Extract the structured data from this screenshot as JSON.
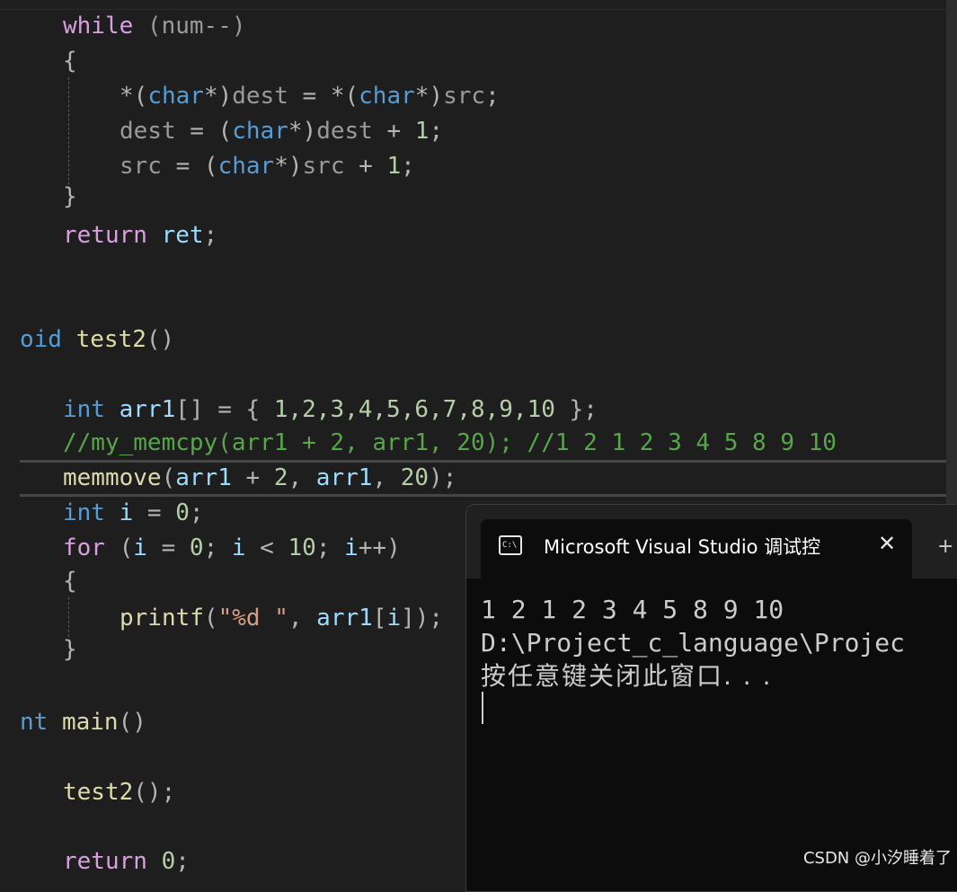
{
  "editor": {
    "lines": {
      "l1": {
        "kw": "while",
        "rest": " (num--)"
      },
      "l2": {
        "text": "{"
      },
      "l3": {
        "a": "*(",
        "t1": "char",
        "b": "*)",
        "v1": "dest",
        "c": " = *(",
        "t2": "char",
        "d": "*)",
        "v2": "src",
        "e": ";"
      },
      "l4": {
        "v1": "dest",
        "a": " = (",
        "t1": "char",
        "b": "*)",
        "v2": "dest",
        "c": " + ",
        "n": "1",
        "d": ";"
      },
      "l5": {
        "v1": "src",
        "a": " = (",
        "t1": "char",
        "b": "*)",
        "v2": "src",
        "c": " + ",
        "n": "1",
        "d": ";"
      },
      "l6": {
        "text": "}"
      },
      "l7": {
        "kw": "return",
        "v": "ret",
        "p": ";"
      },
      "l8": {
        "kw": "oid",
        "fn": "test2",
        "p": "()"
      },
      "l9": {
        "kw": "int",
        "v": "arr1",
        "rest": "[] = { ",
        "nums": "1,2,3,4,5,6,7,8,9,10",
        "end": " };"
      },
      "l10": {
        "text": "//my_memcpy(arr1 + 2, arr1, 20); //1 2 1 2 3 4 5 8 9 10"
      },
      "l11": {
        "fn": "memmove",
        "a": "(",
        "v1": "arr1",
        "b": " + ",
        "n1": "2",
        "c": ", ",
        "v2": "arr1",
        "d": ", ",
        "n2": "20",
        "e": ");"
      },
      "l12": {
        "kw": "int",
        "v": "i",
        "a": " = ",
        "n": "0",
        "b": ";"
      },
      "l13": {
        "kw": "for",
        "a": " (",
        "v1": "i",
        "b": " = ",
        "n1": "0",
        "c": "; ",
        "v2": "i",
        "d": " < ",
        "n2": "10",
        "e": "; ",
        "v3": "i",
        "f": "++)"
      },
      "l14": {
        "text": "{"
      },
      "l15": {
        "fn": "printf",
        "a": "(",
        "s": "\"%d \"",
        "b": ", ",
        "v1": "arr1",
        "c": "[",
        "v2": "i",
        "d": "]);"
      },
      "l16": {
        "text": "}"
      },
      "l17": {
        "kw": "nt",
        "fn": "main",
        "p": "()"
      },
      "l18": {
        "fn": "test2",
        "p": "();"
      },
      "l19": {
        "kw": "return",
        "n": "0",
        "p": ";"
      }
    }
  },
  "console": {
    "title": "Microsoft Visual Studio 调试控",
    "icon_text": "C:\\",
    "close_glyph": "✕",
    "new_tab_glyph": "+",
    "output": [
      "1 2 1 2 3 4 5 8 9 10",
      "D:\\Project_c_language\\Projec",
      "按任意键关闭此窗口. . ."
    ]
  },
  "watermark": "CSDN @小汐睡着了",
  "colors": {
    "editor_bg": "#1e1e1e",
    "keyword": "#569cd6",
    "control": "#d8a0df",
    "function": "#dcdcaa",
    "variable": "#9cdcfe",
    "number": "#b5cea8",
    "string": "#d69d85",
    "comment": "#57a64a",
    "console_bg": "#0c0c0c"
  }
}
